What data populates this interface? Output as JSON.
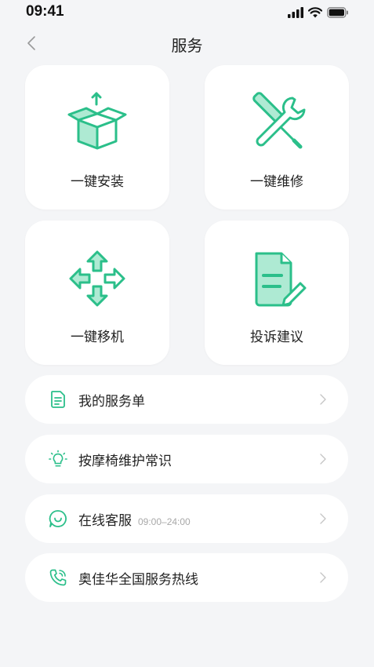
{
  "status": {
    "time": "09:41"
  },
  "header": {
    "title": "服务"
  },
  "colors": {
    "accent": "#2bbf8a",
    "accent_light": "#aeead3",
    "background": "#f4f5f7"
  },
  "grid": [
    {
      "label": "一键安装",
      "icon": "box-upload-icon"
    },
    {
      "label": "一键维修",
      "icon": "tools-icon"
    },
    {
      "label": "一键移机",
      "icon": "move-arrows-icon"
    },
    {
      "label": "投诉建议",
      "icon": "document-edit-icon"
    }
  ],
  "list": [
    {
      "label": "我的服务单",
      "icon": "order-document-icon"
    },
    {
      "label": "按摩椅维护常识",
      "icon": "lightbulb-icon"
    },
    {
      "label": "在线客服",
      "hours": "09:00–24:00",
      "icon": "chat-bubble-icon"
    },
    {
      "label": "奥佳华全国服务热线",
      "icon": "phone-icon"
    }
  ]
}
